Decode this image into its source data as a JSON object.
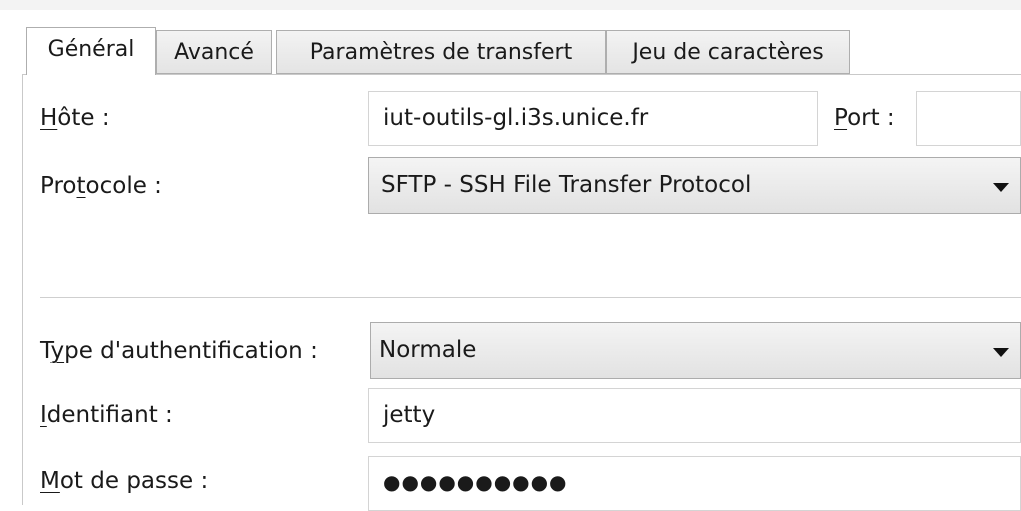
{
  "tabs": [
    {
      "label": "Général",
      "active": true
    },
    {
      "label": "Avancé",
      "active": false
    },
    {
      "label": "Paramètres de transfert",
      "active": false
    },
    {
      "label": "Jeu de caractères",
      "active": false
    }
  ],
  "host": {
    "label_first": "H",
    "label_rest": "ôte :",
    "value": "iut-outils-gl.i3s.unice.fr"
  },
  "port": {
    "label_first": "P",
    "label_rest": "ort :",
    "value": ""
  },
  "protocol": {
    "label_pre": "Pro",
    "label_ul": "t",
    "label_post": "ocole :",
    "value": "SFTP - SSH File Transfer Protocol"
  },
  "auth_type": {
    "label_pre": "T",
    "label_ul": "y",
    "label_post": "pe d'authentification :",
    "value": "Normale"
  },
  "username": {
    "label_first": "I",
    "label_rest": "dentifiant :",
    "value": "jetty"
  },
  "password": {
    "label_first": "M",
    "label_rest": "ot de passe :",
    "value": "●●●●●●●●●●"
  }
}
